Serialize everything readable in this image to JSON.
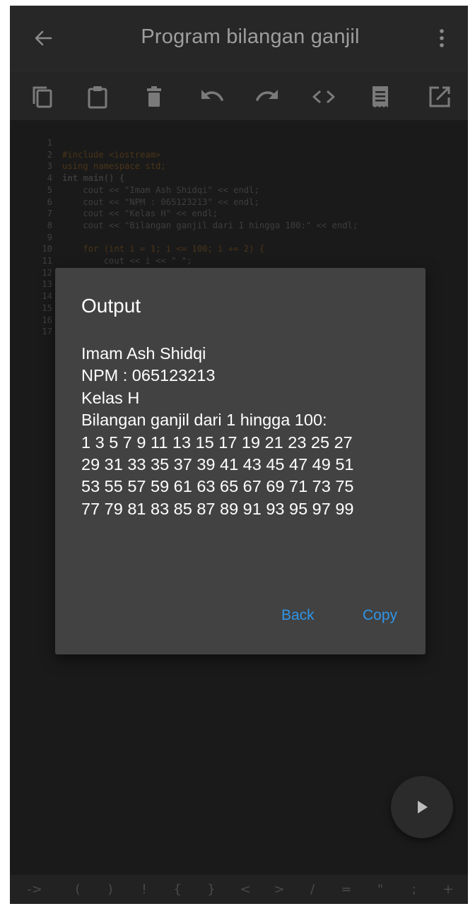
{
  "appbar": {
    "title": "Program bilangan ganjil",
    "back_icon": "arrow-left-icon",
    "menu_icon": "more-vert-icon"
  },
  "toolbar": {
    "icons": [
      "copy-icon",
      "paste-icon",
      "delete-icon",
      "undo-icon",
      "redo-icon",
      "code-icon",
      "document-icon",
      "open-external-icon"
    ]
  },
  "editor": {
    "line_numbers": [
      "1",
      "2",
      "3",
      "4",
      "5",
      "6",
      "7",
      "8",
      "9",
      "10",
      "11",
      "12",
      "13",
      "14",
      "15",
      "16",
      "17"
    ],
    "lines": [
      "#include <iostream>",
      "using namespace std;",
      "int main() {",
      "    cout << \"Imam Ash Shidqi\" << endl;",
      "    cout << \"NPM : 065123213\" << endl;",
      "    cout << \"Kelas H\" << endl;",
      "    cout << \"Bilangan ganjil dari 1 hingga 100:\" << endl;",
      "",
      "    for (int i = 1; i <= 100; i += 2) {",
      "        cout << i << \" \";",
      "    }"
    ]
  },
  "dialog": {
    "title": "Output",
    "output": "Imam Ash Shidqi\nNPM : 065123213\nKelas H\nBilangan ganjil dari 1 hingga 100:\n1 3 5 7 9 11 13 15 17 19 21 23 25 27\n29 31 33 35 37 39 41 43 45 47 49 51\n53 55 57 59 61 63 65 67 69 71 73 75\n77 79 81 83 85 87 89 91 93 95 97 99",
    "back_label": "Back",
    "copy_label": "Copy"
  },
  "fab": {
    "icon": "play-icon"
  },
  "symbols": [
    "->",
    "(",
    ")",
    "!",
    "{",
    "}",
    "<",
    ">",
    "/",
    "=",
    "\"",
    ";",
    "+"
  ],
  "colors": {
    "accent": "#2f95e8",
    "dialog_bg": "#424242",
    "appbar_bg": "#272727",
    "editor_bg": "#1a1a1a"
  }
}
